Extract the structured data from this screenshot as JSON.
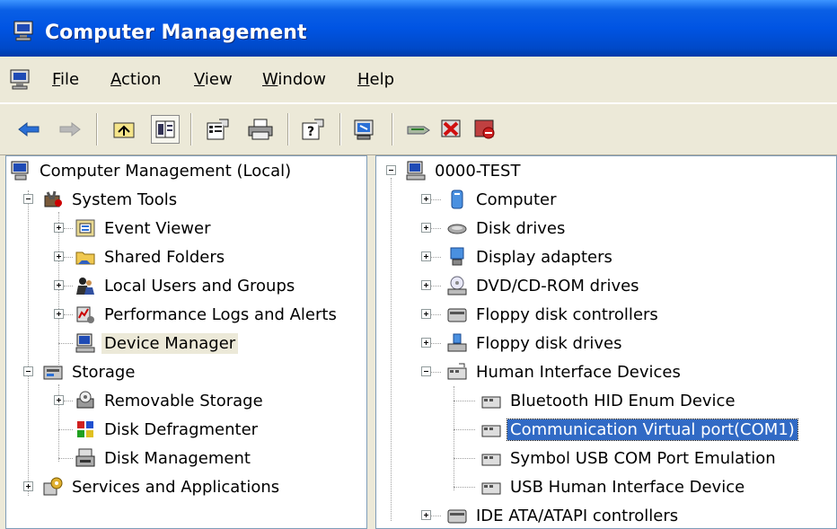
{
  "window": {
    "title": "Computer Management"
  },
  "menu": {
    "items": [
      {
        "label": "File",
        "underline": "F",
        "rest": "ile"
      },
      {
        "label": "Action",
        "underline": "A",
        "rest": "ction"
      },
      {
        "label": "View",
        "underline": "V",
        "rest": "iew"
      },
      {
        "label": "Window",
        "underline": "W",
        "rest": "indow"
      },
      {
        "label": "Help",
        "underline": "H",
        "rest": "elp"
      }
    ]
  },
  "toolbar": {
    "buttons": [
      "back-icon",
      "forward-icon",
      "up-folder-icon",
      "show-hide-tree-icon",
      "properties-icon",
      "print-icon",
      "help-icon",
      "scan-hardware-icon",
      "update-driver-icon",
      "uninstall-icon",
      "disable-icon"
    ]
  },
  "left_tree": {
    "root": "Computer Management (Local)",
    "system_tools": "System Tools",
    "event_viewer": "Event Viewer",
    "shared_folders": "Shared Folders",
    "local_users": "Local Users and Groups",
    "perf_logs": "Performance Logs and Alerts",
    "device_manager": "Device Manager",
    "storage": "Storage",
    "removable_storage": "Removable Storage",
    "disk_defrag": "Disk Defragmenter",
    "disk_management": "Disk Management",
    "services": "Services and Applications"
  },
  "right_tree": {
    "root": "0000-TEST",
    "computer": "Computer",
    "disk_drives": "Disk drives",
    "display_adapters": "Display adapters",
    "dvd": "DVD/CD-ROM drives",
    "floppy_controllers": "Floppy disk controllers",
    "floppy_drives": "Floppy disk drives",
    "hid": "Human Interface Devices",
    "hid_bt": "Bluetooth HID Enum Device",
    "hid_com": "Communication Virtual port(COM1)",
    "hid_symbol": "Symbol USB COM Port Emulation",
    "hid_usb": "USB Human Interface Device",
    "ide": "IDE ATA/ATAPI controllers"
  }
}
